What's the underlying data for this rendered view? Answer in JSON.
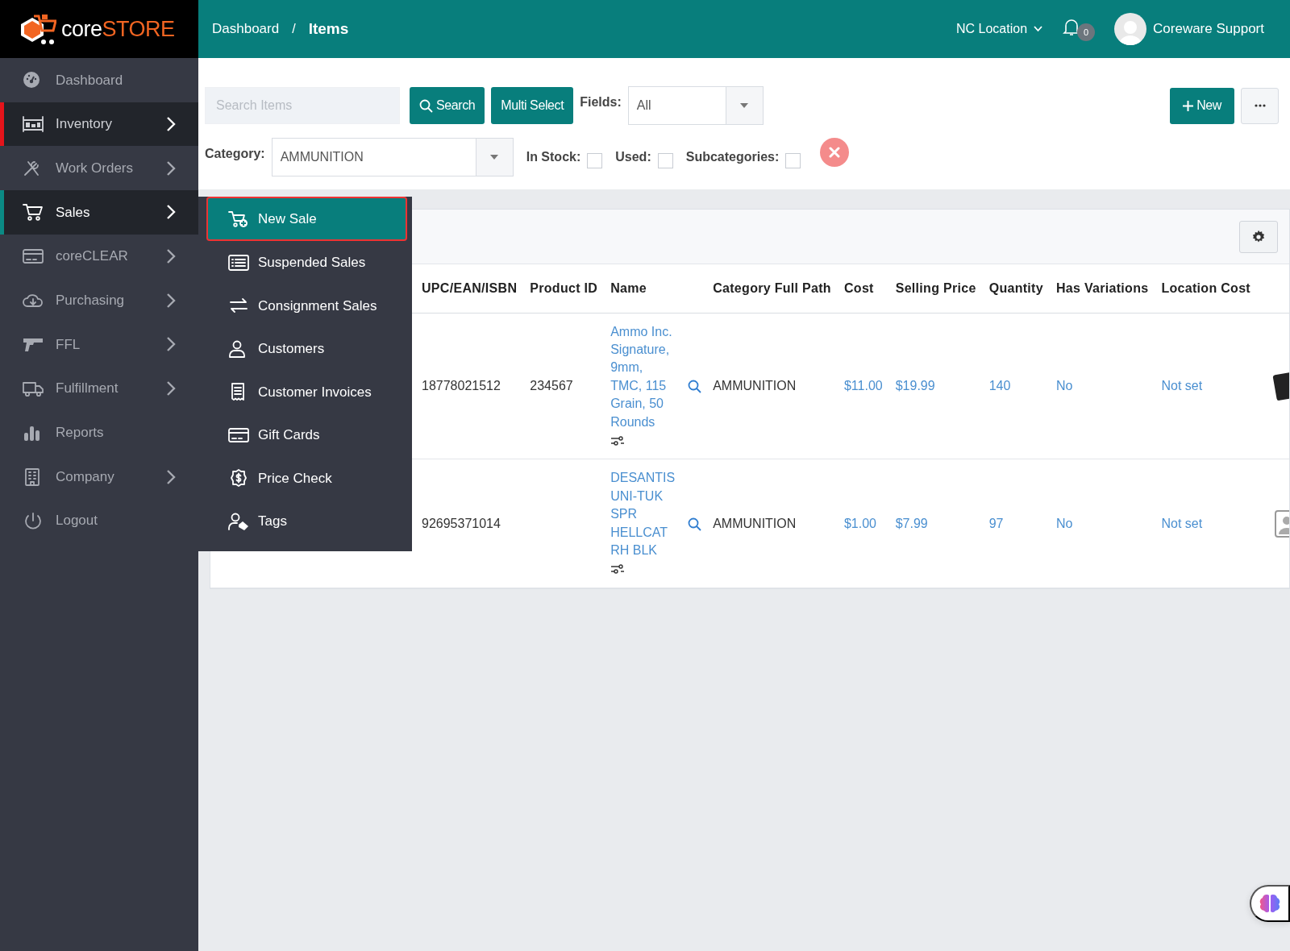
{
  "brand": {
    "prefix": "core",
    "suffix": "STORE"
  },
  "breadcrumb": [
    {
      "label": "Dashboard",
      "current": false
    },
    {
      "label": "Items",
      "current": true
    }
  ],
  "breadcrumb_separator": "/",
  "header": {
    "location": "NC Location",
    "notification_count": "0",
    "user": "Coreware Support"
  },
  "sidebar": {
    "items": [
      {
        "label": "Dashboard",
        "has_submenu": false,
        "selected": false
      },
      {
        "label": "Inventory",
        "has_submenu": true,
        "selected": false,
        "color": "#e5141b"
      },
      {
        "label": "Work Orders",
        "has_submenu": true,
        "selected": false
      },
      {
        "label": "Sales",
        "has_submenu": true,
        "selected": true,
        "color": "#0b8a84"
      },
      {
        "label": "coreCLEAR",
        "has_submenu": true,
        "selected": false
      },
      {
        "label": "Purchasing",
        "has_submenu": true,
        "selected": false
      },
      {
        "label": "FFL",
        "has_submenu": true,
        "selected": false
      },
      {
        "label": "Fulfillment",
        "has_submenu": true,
        "selected": false
      },
      {
        "label": "Reports",
        "has_submenu": false,
        "selected": false
      },
      {
        "label": "Company",
        "has_submenu": true,
        "selected": false
      },
      {
        "label": "Logout",
        "has_submenu": false,
        "selected": false
      }
    ]
  },
  "sales_menu": [
    {
      "label": "New Sale",
      "selected": true
    },
    {
      "label": "Suspended Sales",
      "selected": false
    },
    {
      "label": "Consignment Sales",
      "selected": false
    },
    {
      "label": "Customers",
      "selected": false
    },
    {
      "label": "Customer Invoices",
      "selected": false
    },
    {
      "label": "Gift Cards",
      "selected": false
    },
    {
      "label": "Price Check",
      "selected": false
    },
    {
      "label": "Tags",
      "selected": false
    }
  ],
  "toolbar": {
    "search": {
      "placeholder": "Search Items"
    },
    "search_button": "Search",
    "multi_select_button": "Multi Select",
    "fields_label": "Fields:",
    "fields_value": "All",
    "new_button": "New"
  },
  "filters": {
    "category_label": "Category:",
    "category_value": "AMMUNITION",
    "checkboxes": [
      {
        "label": "In Stock:",
        "checked": false
      },
      {
        "label": "Used:",
        "checked": false
      },
      {
        "label": "Subcategories:",
        "checked": false
      }
    ]
  },
  "table": {
    "columns": [
      "UPC/EAN/ISBN",
      "Product ID",
      "Name",
      "Category Full Path",
      "Cost",
      "Selling Price",
      "Quantity",
      "Has Variations",
      "Location Cost"
    ],
    "rows": [
      {
        "upc": "18778021512",
        "product_id": "234567",
        "name": "Ammo Inc. Signature, 9mm, TMC, 115 Grain, 50 Rounds",
        "category": "AMMUNITION",
        "cost": "$11.00",
        "selling_price": "$19.99",
        "quantity": "140",
        "has_variations": "No",
        "location_cost": "Not set",
        "kind": "photo"
      },
      {
        "upc": "92695371014",
        "product_id": "",
        "name": "DESANTIS UNI-TUK SPR HELLCAT RH BLK",
        "category": "AMMUNITION",
        "cost": "$1.00",
        "selling_price": "$7.99",
        "quantity": "97",
        "has_variations": "No",
        "location_cost": "Not set",
        "kind": "placeholder"
      }
    ]
  }
}
